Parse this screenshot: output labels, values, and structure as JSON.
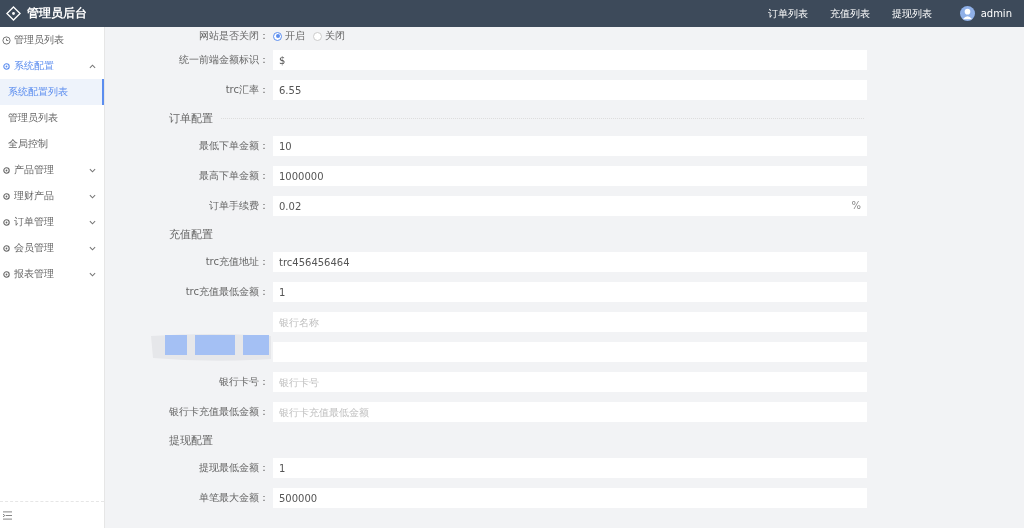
{
  "header": {
    "title": "管理员后台",
    "nav": [
      "订单列表",
      "充值列表",
      "提现列表"
    ],
    "user": "admin"
  },
  "sidebar": {
    "items": [
      {
        "kind": "link",
        "label": "管理员列表"
      },
      {
        "kind": "group",
        "label": "系统配置",
        "expanded": true,
        "children": [
          {
            "label": "系统配置列表",
            "selected": true
          },
          {
            "label": "管理员列表",
            "selected": false
          },
          {
            "label": "全局控制",
            "selected": false
          }
        ]
      },
      {
        "kind": "group",
        "label": "产品管理",
        "expanded": false
      },
      {
        "kind": "group",
        "label": "理财产品",
        "expanded": false
      },
      {
        "kind": "group",
        "label": "订单管理",
        "expanded": false
      },
      {
        "kind": "group",
        "label": "会员管理",
        "expanded": false
      },
      {
        "kind": "group",
        "label": "报表管理",
        "expanded": false
      }
    ]
  },
  "form": [
    {
      "kind": "radio",
      "label": "网站是否关闭：",
      "options": [
        {
          "label": "开启",
          "selected": true
        },
        {
          "label": "关闭",
          "selected": false
        }
      ]
    },
    {
      "kind": "input",
      "label": "统一前端金额标识：",
      "value": "$"
    },
    {
      "kind": "input",
      "label": "trc汇率：",
      "value": "6.55"
    },
    {
      "kind": "section",
      "label": "订单配置"
    },
    {
      "kind": "input",
      "label": "最低下单金额：",
      "value": "10"
    },
    {
      "kind": "input",
      "label": "最高下单金额：",
      "value": "1000000"
    },
    {
      "kind": "input",
      "label": "订单手续费：",
      "value": "0.02",
      "suffix": "%"
    },
    {
      "kind": "section",
      "label": "充值配置"
    },
    {
      "kind": "input",
      "label": "trc充值地址：",
      "value": "trc456456464"
    },
    {
      "kind": "input",
      "label": "trc充值最低金额：",
      "value": "1"
    },
    {
      "kind": "input",
      "placeholder": "银行名称"
    },
    {
      "kind": "input"
    },
    {
      "kind": "input",
      "label": "银行卡号：",
      "placeholder": "银行卡号"
    },
    {
      "kind": "input",
      "label": "银行卡充值最低金额：",
      "placeholder": "银行卡充值最低金额"
    },
    {
      "kind": "section",
      "label": "提现配置"
    },
    {
      "kind": "input",
      "label": "提现最低金额：",
      "value": "1"
    },
    {
      "kind": "input",
      "label": "单笔最大金额：",
      "value": "500000"
    }
  ]
}
